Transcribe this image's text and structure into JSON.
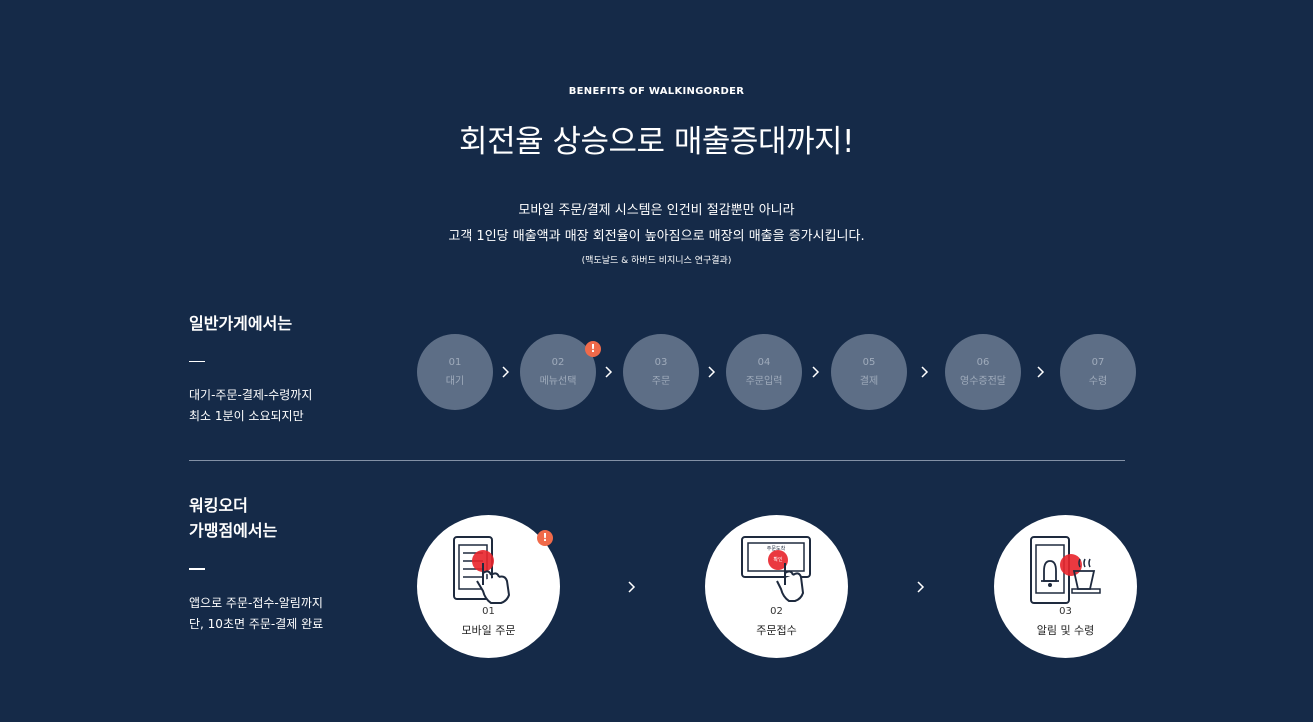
{
  "hero": {
    "eyebrow": "BENEFITS OF WALKINGORDER",
    "headline": "회전율 상승으로 매출증대까지!",
    "description_line1": "모바일 주문/결제 시스템은 인건비 절감뿐만 아니라",
    "description_line2": "고객 1인당 매출액과 매장 회전율이 높아짐으로 매장의 매출을 증가시킵니다.",
    "source": "(맥도날드 & 하버드 비지니스 연구결과)"
  },
  "general_store": {
    "title": "일반가게에서는",
    "text_line1": "대기-주문-결제-수령까지",
    "text_line2": "최소 1분이 소요되지만",
    "steps": [
      {
        "num": "01",
        "label": "대기"
      },
      {
        "num": "02",
        "label": "메뉴선택",
        "alert": "!"
      },
      {
        "num": "03",
        "label": "주문"
      },
      {
        "num": "04",
        "label": "주문입력"
      },
      {
        "num": "05",
        "label": "결제"
      },
      {
        "num": "06",
        "label": "영수증전달"
      },
      {
        "num": "07",
        "label": "수령"
      }
    ]
  },
  "walkingorder_store": {
    "title_line1": "워킹오더",
    "title_line2": "가맹점에서는",
    "text_line1": "앱으로 주문-접수-알림까지",
    "text_line2": "단, 10초면 주문-결제 완료",
    "steps": [
      {
        "num": "01",
        "label": "모바일 주문",
        "icon": "mobile-order-icon",
        "alert": "!"
      },
      {
        "num": "02",
        "label": "주문접수",
        "icon": "order-receive-icon",
        "screen_text": "주문도착",
        "button_text": "확인"
      },
      {
        "num": "03",
        "label": "알림 및 수령",
        "icon": "notification-pickup-icon"
      }
    ]
  },
  "colors": {
    "background": "#152a48",
    "step_circle": "#5d6e86",
    "alert": "#f06a4a",
    "tap_highlight": "#e8232b"
  }
}
